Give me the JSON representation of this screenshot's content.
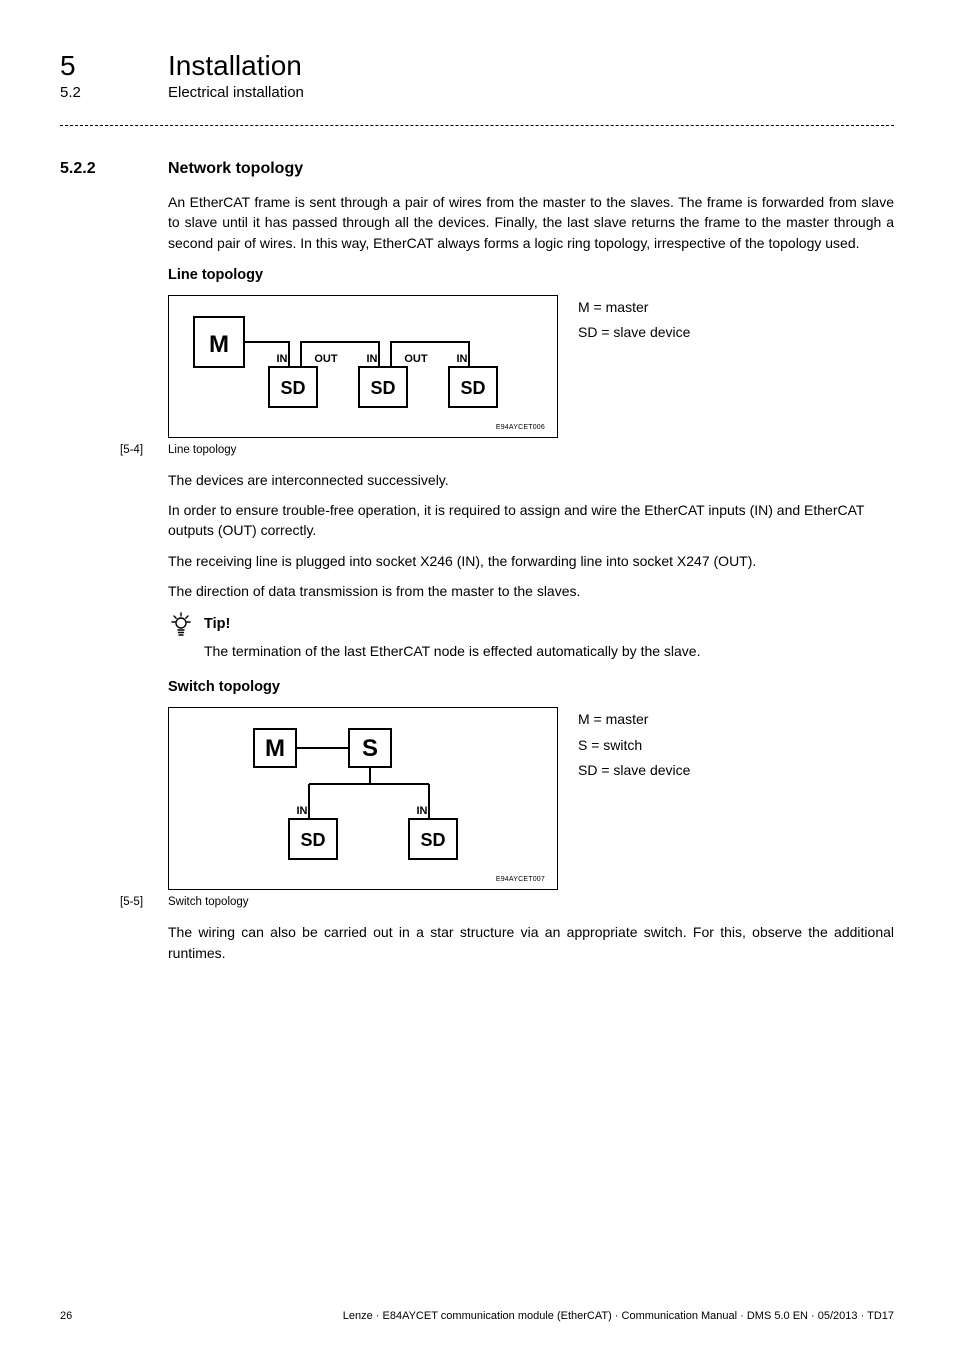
{
  "chapter": {
    "num": "5",
    "title": "Installation"
  },
  "sub": {
    "num": "5.2",
    "title": "Electrical installation"
  },
  "section": {
    "num": "5.2.2",
    "title": "Network topology"
  },
  "p1": "An EtherCAT frame is sent through a pair of wires from the master to the slaves. The frame is forwarded from slave to slave until it has passed through all the devices. Finally, the last slave returns the frame to the master through a second pair of wires. In this way, EtherCAT always forms a logic ring topology, irrespective of the topology used.",
  "h_line": "Line topology",
  "fig1": {
    "M": "M",
    "SD": "SD",
    "IN": "IN",
    "OUT": "OUT",
    "code": "E94AYCET006",
    "legend_m": "M = master",
    "legend_sd": "SD = slave device",
    "cap_num": "[5-4]",
    "cap_txt": "Line topology"
  },
  "p2": "The devices are interconnected successively.",
  "p3": "In order to ensure trouble-free operation, it is required to assign and wire the EtherCAT inputs (IN) and EtherCAT outputs (OUT) correctly.",
  "p4": "The receiving line is plugged into socket X246 (IN), the forwarding line into socket X247 (OUT).",
  "p5": "The direction of data transmission is from the master to the slaves.",
  "tip": {
    "label": "Tip!",
    "text": "The termination of the last EtherCAT node is effected automatically by the slave."
  },
  "h_switch": "Switch topology",
  "fig2": {
    "M": "M",
    "S": "S",
    "SD": "SD",
    "IN": "IN",
    "code": "E94AYCET007",
    "legend_m": "M = master",
    "legend_s": "S = switch",
    "legend_sd": "SD = slave device",
    "cap_num": "[5-5]",
    "cap_txt": "Switch topology"
  },
  "p6": "The wiring can also be carried out in a star structure via an appropriate switch. For this, observe the additional runtimes.",
  "footer": {
    "page": "26",
    "doc": "Lenze · E84AYCET communication module (EtherCAT) · Communication Manual · DMS 5.0 EN · 05/2013 · TD17"
  }
}
